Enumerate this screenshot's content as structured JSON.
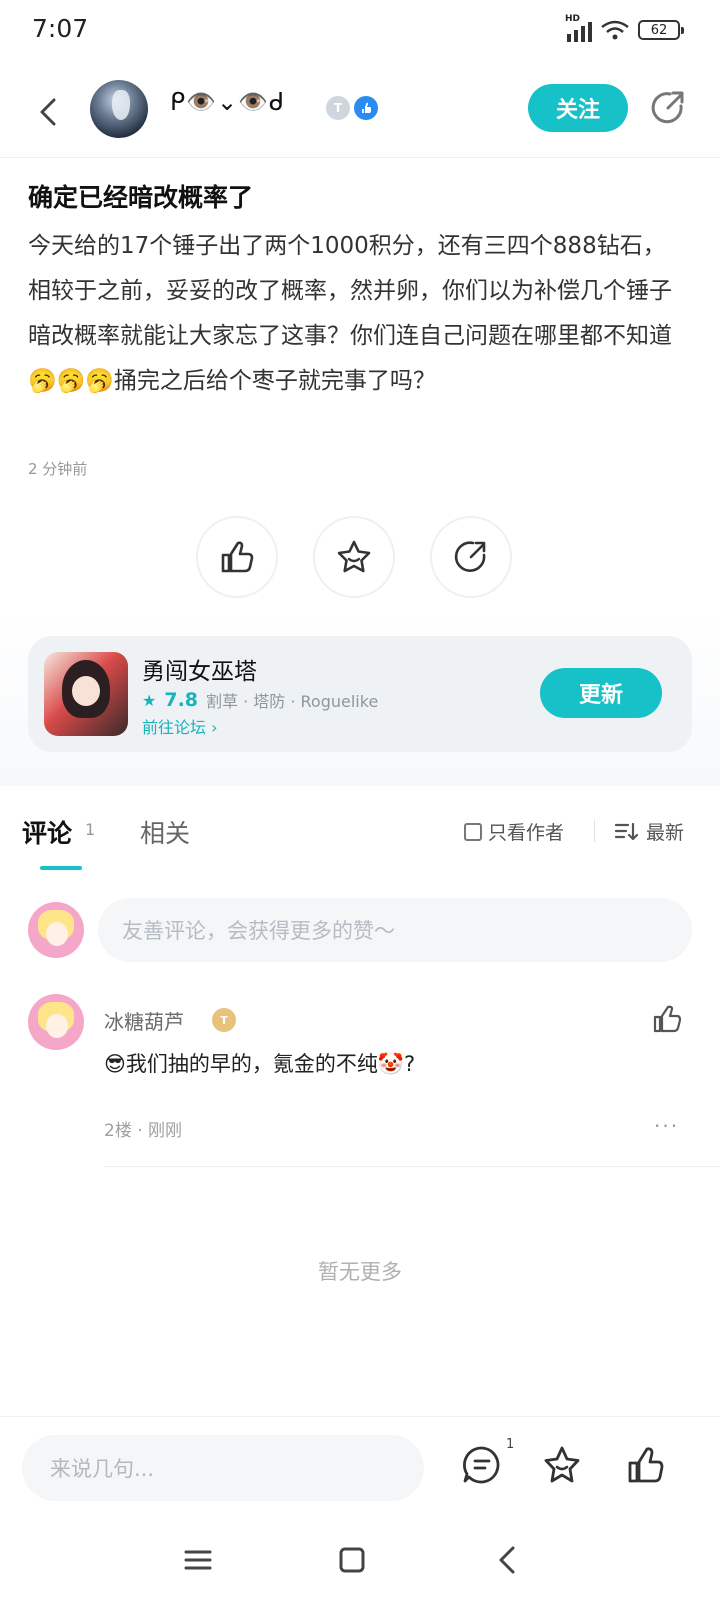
{
  "status": {
    "time": "7:07",
    "network": "HD",
    "battery": "62"
  },
  "header": {
    "username": "ᑭ👁️⌄👁️ᑯ",
    "level_badge": "T",
    "follow_label": "关注"
  },
  "post": {
    "title": "确定已经暗改概率了",
    "body": "今天给的17个锤子出了两个1000积分，还有三四个888钻石，相较于之前，妥妥的改了概率，然并卵，你们以为补偿几个锤子暗改概率就能让大家忘了这事？你们连自己问题在哪里都不知道🥱🥱🥱捅完之后给个枣子就完事了吗？",
    "time": "2 分钟前"
  },
  "game": {
    "name": "勇闯女巫塔",
    "score": "7.8",
    "tags": "割草 · 塔防 · Roguelike",
    "forum_link": "前往论坛",
    "update_label": "更新"
  },
  "tabs": {
    "comments_label": "评论",
    "comments_count": "1",
    "related_label": "相关",
    "only_author_label": "只看作者",
    "sort_label": "最新"
  },
  "comment_input": {
    "placeholder": "友善评论，会获得更多的赞～"
  },
  "comments": [
    {
      "user": "冰糖葫芦",
      "badge": "T",
      "text": "😎我们抽的早的，氪金的不纯🤡?",
      "meta": "2楼 · 刚刚",
      "more": "···"
    }
  ],
  "no_more_label": "暂无更多",
  "bottom_bar": {
    "reply_placeholder": "来说几句...",
    "comment_count": "1"
  },
  "colors": {
    "accent": "#16c1c8",
    "verified": "#2a8cf2"
  }
}
